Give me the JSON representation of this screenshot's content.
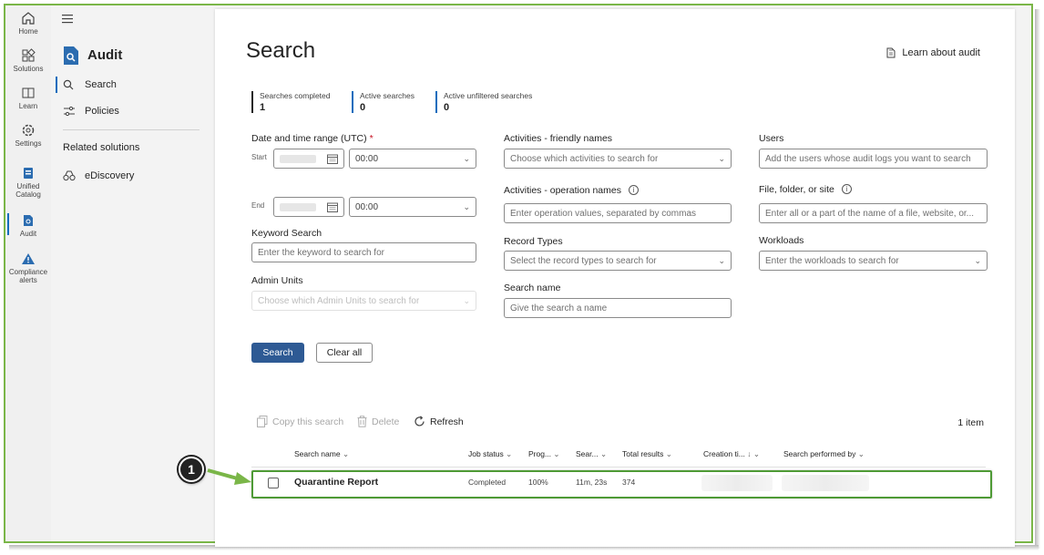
{
  "rail": {
    "items": [
      {
        "label": "Home"
      },
      {
        "label": "Solutions"
      },
      {
        "label": "Learn"
      },
      {
        "label": "Settings"
      },
      {
        "label": "Unified Catalog"
      },
      {
        "label": "Audit"
      },
      {
        "label": "Compliance alerts"
      }
    ]
  },
  "nav": {
    "app_title": "Audit",
    "items": [
      {
        "label": "Search",
        "selected": true
      },
      {
        "label": "Policies"
      }
    ],
    "related_heading": "Related solutions",
    "related_items": [
      {
        "label": "eDiscovery"
      }
    ]
  },
  "main": {
    "title": "Search",
    "learn_link": "Learn about audit",
    "stats": [
      {
        "label": "Searches completed",
        "value": "1"
      },
      {
        "label": "Active searches",
        "value": "0"
      },
      {
        "label": "Active unfiltered searches",
        "value": "0"
      }
    ],
    "form": {
      "date_label": "Date and time range (UTC)",
      "required_mark": "*",
      "start_label": "Start",
      "end_label": "End",
      "start_time": "00:00",
      "end_time": "00:00",
      "keyword_label": "Keyword Search",
      "keyword_placeholder": "Enter the keyword to search for",
      "admin_units_label": "Admin Units",
      "admin_units_placeholder": "Choose which Admin Units to search for",
      "activities_friendly_label": "Activities - friendly names",
      "activities_friendly_placeholder": "Choose which activities to search for",
      "activities_operation_label": "Activities - operation names",
      "activities_operation_placeholder": "Enter operation values, separated by commas",
      "record_types_label": "Record Types",
      "record_types_placeholder": "Select the record types to search for",
      "search_name_label": "Search name",
      "search_name_placeholder": "Give the search a name",
      "users_label": "Users",
      "users_placeholder": "Add the users whose audit logs you want to search",
      "file_label": "File, folder, or site",
      "file_placeholder": "Enter all or a part of the name of a file, website, or...",
      "workloads_label": "Workloads",
      "workloads_placeholder": "Enter the workloads to search for"
    },
    "buttons": {
      "search": "Search",
      "clear": "Clear all"
    },
    "toolbar": {
      "copy": "Copy this search",
      "delete": "Delete",
      "refresh": "Refresh",
      "count": "1 item"
    },
    "table": {
      "columns": [
        "Search name",
        "Job status",
        "Prog...",
        "Sear...",
        "Total results",
        "Creation ti...",
        "Search performed by"
      ],
      "rows": [
        {
          "name": "Quarantine Report",
          "status": "Completed",
          "progress": "100%",
          "duration": "11m, 23s",
          "total": "374"
        }
      ]
    }
  },
  "callout": {
    "number": "1"
  },
  "colors": {
    "accent": "#0f6cbd",
    "primary_button": "#2e5a94",
    "highlight": "#4e9a35"
  }
}
